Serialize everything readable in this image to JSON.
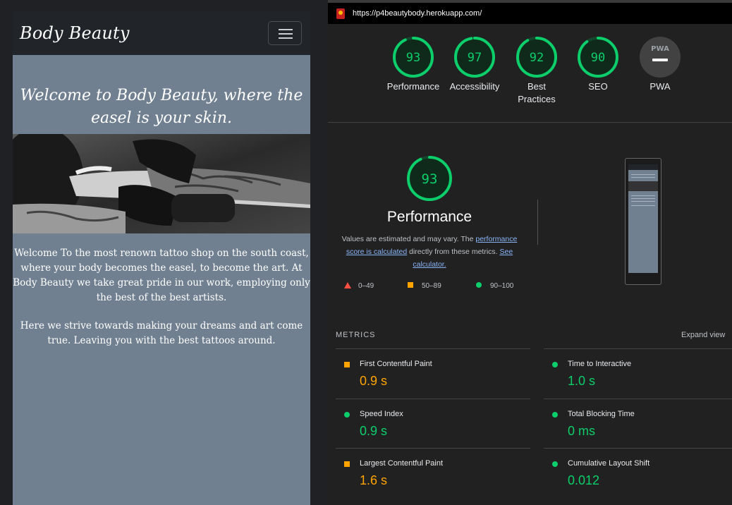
{
  "site": {
    "brand": "Body Beauty",
    "heading": "Welcome to Body Beauty, where the easel is your skin.",
    "paragraph1": "Welcome To the most renown tattoo shop on the south coast, where your body becomes the easel, to become the art. At Body Beauty we take great pride in our work, employing only the best of the best artists.",
    "paragraph2": "Here we strive towards making your dreams and art come true. Leaving you with the best tattoos around.",
    "background_color": "#708090"
  },
  "lighthouse": {
    "url": "https://p4beautybody.herokuapp.com/",
    "categories": [
      {
        "label": "Performance",
        "score": 93
      },
      {
        "label": "Accessibility",
        "score": 97
      },
      {
        "label": "Best Practices",
        "score": 92
      },
      {
        "label": "SEO",
        "score": 90
      }
    ],
    "pwa_label": "PWA",
    "pwa_badge": "PWA",
    "performance": {
      "score": 93,
      "title": "Performance",
      "desc_before": "Values are estimated and may vary. The ",
      "desc_link1": "performance score is calculated",
      "desc_middle": " directly from these metrics. ",
      "desc_link2": "See calculator."
    },
    "legend": {
      "fail": "0–49",
      "average": "50–89",
      "pass": "90–100"
    },
    "metrics_title": "METRICS",
    "expand_view": "Expand view",
    "metrics": [
      {
        "name": "First Contentful Paint",
        "value": "0.9 s",
        "rating": "average"
      },
      {
        "name": "Time to Interactive",
        "value": "1.0 s",
        "rating": "pass"
      },
      {
        "name": "Speed Index",
        "value": "0.9 s",
        "rating": "pass"
      },
      {
        "name": "Total Blocking Time",
        "value": "0 ms",
        "rating": "pass"
      },
      {
        "name": "Largest Contentful Paint",
        "value": "1.6 s",
        "rating": "average"
      },
      {
        "name": "Cumulative Layout Shift",
        "value": "0.012",
        "rating": "pass"
      }
    ],
    "colors": {
      "pass": "#0cce6b",
      "average": "#ffa400",
      "fail": "#ff4e42"
    }
  }
}
